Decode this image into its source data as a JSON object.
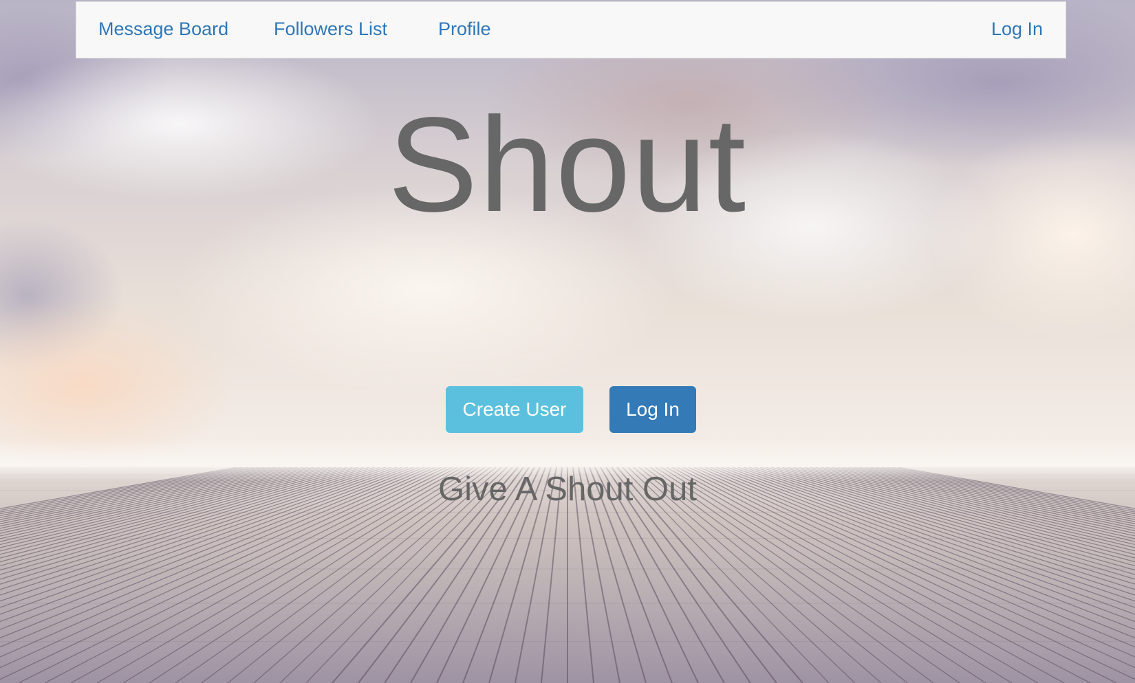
{
  "navbar": {
    "links": [
      {
        "label": "Message Board"
      },
      {
        "label": "Followers List"
      },
      {
        "label": "Profile"
      }
    ],
    "login_label": "Log In",
    "link_color": "#2f76b8"
  },
  "hero": {
    "title": "Shout",
    "tagline": "Give A Shout Out",
    "create_user_label": "Create User",
    "login_label": "Log In",
    "create_user_color": "#5bc0de",
    "login_color": "#337ab7"
  },
  "background": {
    "description_icon": "sky-and-wooden-deck-background"
  }
}
